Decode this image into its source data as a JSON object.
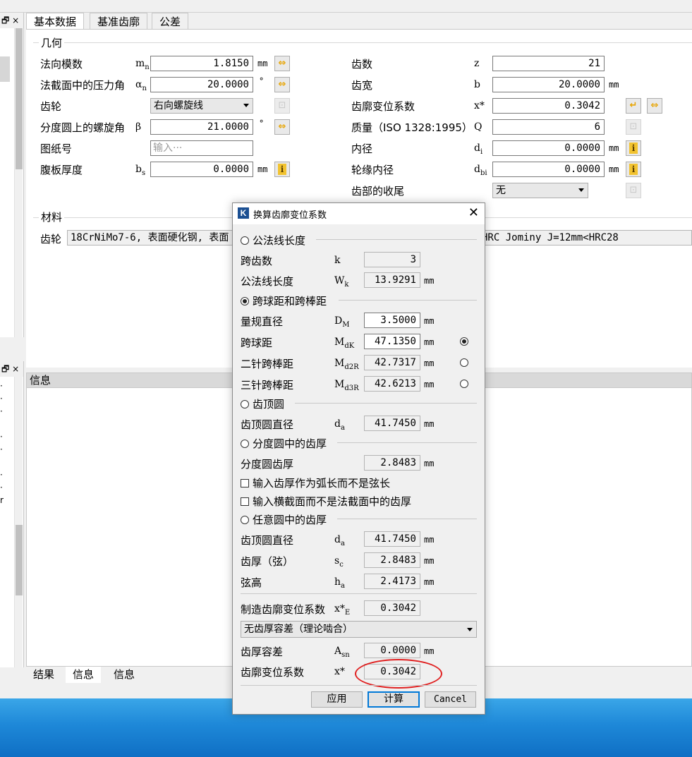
{
  "tabs": [
    "基本数据",
    "基准齿廓",
    "公差"
  ],
  "left_panel": {
    "controls": "🗗 ×"
  },
  "geometry": {
    "group_label": "几何",
    "normal_module": {
      "label": "法向模数",
      "symbol": "m",
      "sub": "n",
      "value": "1.8150",
      "unit": "mm"
    },
    "pressure_angle": {
      "label": "法截面中的压力角",
      "symbol": "α",
      "sub": "n",
      "value": "20.0000",
      "unit": "°"
    },
    "gear": {
      "label": "齿轮",
      "value": "右向螺旋线"
    },
    "helix_angle": {
      "label": "分度圆上的螺旋角",
      "symbol": "β",
      "value": "21.0000",
      "unit": "°"
    },
    "drawing_no": {
      "label": "图纸号",
      "placeholder": "输入···"
    },
    "web_thickness": {
      "label": "腹板厚度",
      "symbol": "b",
      "sub": "s",
      "value": "0.0000",
      "unit": "mm"
    },
    "teeth": {
      "label": "齿数",
      "symbol": "z",
      "value": "21"
    },
    "face_width": {
      "label": "齿宽",
      "symbol": "b",
      "value": "20.0000",
      "unit": "mm"
    },
    "profile_shift": {
      "label": "齿廓变位系数",
      "symbol": "x*",
      "value": "0.3042"
    },
    "quality": {
      "label": "质量（ISO 1328:1995）",
      "symbol": "Q",
      "value": "6"
    },
    "inner_diameter": {
      "label": "内径",
      "symbol": "d",
      "sub": "i",
      "value": "0.0000",
      "unit": "mm"
    },
    "rim_inner_diameter": {
      "label": "轮缘内径",
      "symbol": "d",
      "sub": "bi",
      "value": "0.0000",
      "unit": "mm"
    },
    "tip_relief": {
      "label": "齿部的收尾",
      "value": "无"
    }
  },
  "material": {
    "group_label": "材料",
    "label": "齿轮",
    "value_left": "18CrNiMo7-6, 表面硬化钢, 表面",
    "value_right": "HRC Jominy J=12mm<HRC28"
  },
  "info_panel": {
    "title": "信息"
  },
  "bottom_tabs": [
    "结果",
    "信息",
    "信息"
  ],
  "dialog": {
    "icon": "K",
    "title": "换算齿廓变位系数",
    "close": "✕",
    "sec_wk": "公法线长度",
    "k": {
      "label": "跨齿数",
      "symbol": "k",
      "value": "3"
    },
    "wk": {
      "label": "公法线长度",
      "symbol": "W",
      "sub": "k",
      "value": "13.9291",
      "unit": "mm"
    },
    "sec_ball": "跨球距和跨棒距",
    "dm": {
      "label": "量规直径",
      "symbol": "D",
      "sub": "M",
      "value": "3.5000",
      "unit": "mm"
    },
    "mdk": {
      "label": "跨球距",
      "symbol": "M",
      "sub": "dK",
      "value": "47.1350",
      "unit": "mm"
    },
    "md2r": {
      "label": "二针跨棒距",
      "symbol": "M",
      "sub": "d2R",
      "value": "42.7317",
      "unit": "mm"
    },
    "md3r": {
      "label": "三针跨棒距",
      "symbol": "M",
      "sub": "d3R",
      "value": "42.6213",
      "unit": "mm"
    },
    "sec_tip": "齿顶圆",
    "da": {
      "label": "齿顶圆直径",
      "symbol": "d",
      "sub": "a",
      "value": "41.7450",
      "unit": "mm"
    },
    "sec_pitch": "分度圆中的齿厚",
    "pitch_thick": {
      "label": "分度圆齿厚",
      "value": "2.8483",
      "unit": "mm"
    },
    "chk_arc": "输入齿厚作为弧长而不是弦长",
    "chk_transverse": "输入横截面而不是法截面中的齿厚",
    "sec_any": "任意圆中的齿厚",
    "da2": {
      "label": "齿顶圆直径",
      "symbol": "d",
      "sub": "a",
      "value": "41.7450",
      "unit": "mm"
    },
    "sc": {
      "label": "齿厚（弦）",
      "symbol": "s",
      "sub": "c",
      "value": "2.8483",
      "unit": "mm"
    },
    "ha": {
      "label": "弦高",
      "symbol": "h",
      "sub": "a",
      "value": "2.4173",
      "unit": "mm"
    },
    "xe": {
      "label": "制造齿廓变位系数",
      "symbol": "x*",
      "sub": "E",
      "value": "0.3042"
    },
    "tolerance_select": "无齿厚容差（理论啮合）",
    "asn": {
      "label": "齿厚容差",
      "symbol": "A",
      "sub": "sn",
      "value": "0.0000",
      "unit": "mm"
    },
    "x_result": {
      "label": "齿廓变位系数",
      "symbol": "x*",
      "value": "0.3042"
    },
    "btn_apply": "应用",
    "btn_calc": "计算",
    "btn_cancel": "Cancel"
  },
  "colors": {
    "annotation_circle": "#e02020",
    "desktop": "#1e88d8"
  }
}
